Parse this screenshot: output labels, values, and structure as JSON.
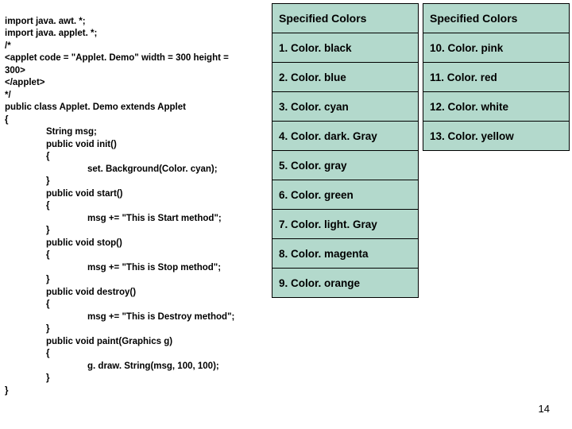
{
  "code": {
    "l1": "import java. awt. *;",
    "l2": "import java. applet. *;",
    "l3": "/*",
    "l4": "<applet code = \"Applet. Demo\" width = 300 height =",
    "l5": "300>",
    "l6": "</applet>",
    "l7": "*/",
    "l8": "public class Applet. Demo extends Applet",
    "l9": "{",
    "l10": "String msg;",
    "l11": "public void init()",
    "l12": "{",
    "l13": "set. Background(Color. cyan);",
    "l14": "}",
    "l15": "public void start()",
    "l16": "{",
    "l17": "msg += \"This is Start method\";",
    "l18": "}",
    "l19": "public void stop()",
    "l20": "{",
    "l21": "msg += \"This is Stop method\";",
    "l22": "}",
    "l23": "public void destroy()",
    "l24": "{",
    "l25": "msg += \"This is Destroy method\";",
    "l26": "}",
    "l27": "public void paint(Graphics g)",
    "l28": "{",
    "l29": "g. draw. String(msg, 100, 100);",
    "l30": "}",
    "l31": "}"
  },
  "table1": {
    "header": "Specified Colors",
    "rows": [
      "1.  Color. black",
      "2.  Color. blue",
      "3.  Color. cyan",
      "4.  Color. dark. Gray",
      "5.  Color. gray",
      "6.  Color. green",
      "7.  Color. light. Gray",
      "8.  Color. magenta",
      "9.  Color. orange"
    ]
  },
  "table2": {
    "header": "Specified Colors",
    "rows": [
      "10.  Color. pink",
      "11.  Color. red",
      "12.  Color. white",
      "13.  Color. yellow"
    ]
  },
  "page_number": "14"
}
